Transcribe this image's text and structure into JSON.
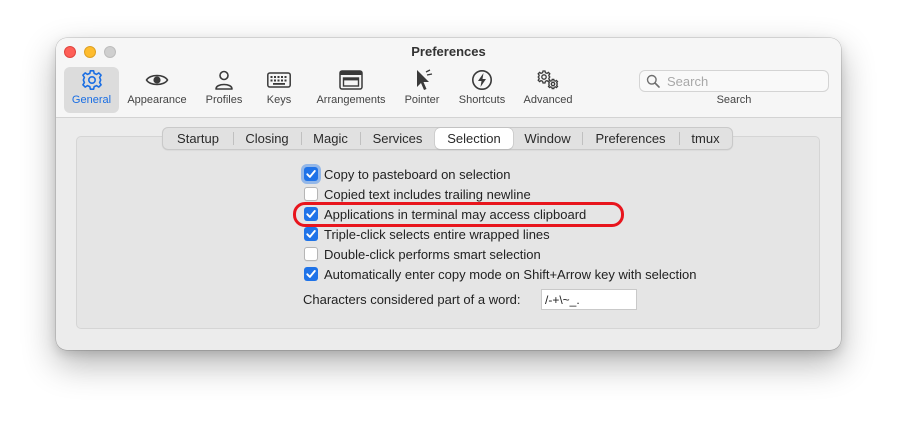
{
  "window": {
    "title": "Preferences"
  },
  "toolbar": {
    "items": [
      {
        "label": "General",
        "icon": "gear-icon",
        "selected": true
      },
      {
        "label": "Appearance",
        "icon": "eye-icon"
      },
      {
        "label": "Profiles",
        "icon": "person-icon"
      },
      {
        "label": "Keys",
        "icon": "keyboard-icon"
      },
      {
        "label": "Arrangements",
        "icon": "windows-icon"
      },
      {
        "label": "Pointer",
        "icon": "cursor-icon"
      },
      {
        "label": "Shortcuts",
        "icon": "bolt-icon"
      },
      {
        "label": "Advanced",
        "icon": "gears-icon"
      }
    ],
    "search": {
      "placeholder": "Search",
      "label": "Search"
    }
  },
  "tabs": [
    "Startup",
    "Closing",
    "Magic",
    "Services",
    "Selection",
    "Window",
    "Preferences",
    "tmux"
  ],
  "active_tab": "Selection",
  "options": [
    {
      "label": "Copy to pasteboard on selection",
      "checked": true
    },
    {
      "label": "Copied text includes trailing newline",
      "checked": false
    },
    {
      "label": "Applications in terminal may access clipboard",
      "checked": true
    },
    {
      "label": "Triple-click selects entire wrapped lines",
      "checked": true
    },
    {
      "label": "Double-click performs smart selection",
      "checked": false
    },
    {
      "label": "Automatically enter copy mode on Shift+Arrow key with selection",
      "checked": true
    }
  ],
  "word_chars": {
    "label": "Characters considered part of a word:",
    "value": "/-+\\~_."
  },
  "colors": {
    "accent": "#1f73e8",
    "highlight_ring": "#e8151d",
    "selected_label": "#1a6ee3"
  }
}
